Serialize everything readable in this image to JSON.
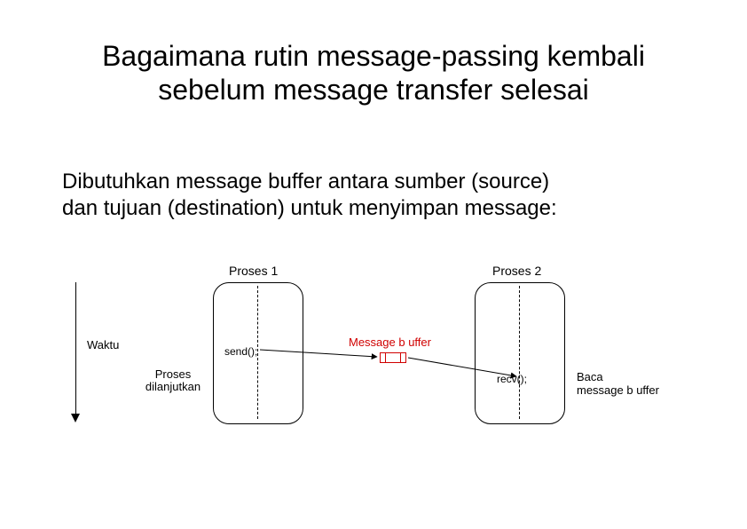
{
  "title_line1": "Bagaimana rutin message-passing kembali",
  "title_line2": "sebelum message transfer selesai",
  "body_line1": "Dibutuhkan message buffer antara sumber (source)",
  "body_line2": "dan tujuan (destination) untuk menyimpan message:",
  "diagram": {
    "process1_label": "Proses 1",
    "process2_label": "Proses 2",
    "time_label": "Waktu",
    "continue_label_l1": "Proses",
    "continue_label_l2": "dilanjutkan",
    "send_label": "send();",
    "recv_label": "recv();",
    "msg_buffer_label": "Message b uffer",
    "read_label_l1": "Baca",
    "read_label_l2": "message b uffer"
  }
}
